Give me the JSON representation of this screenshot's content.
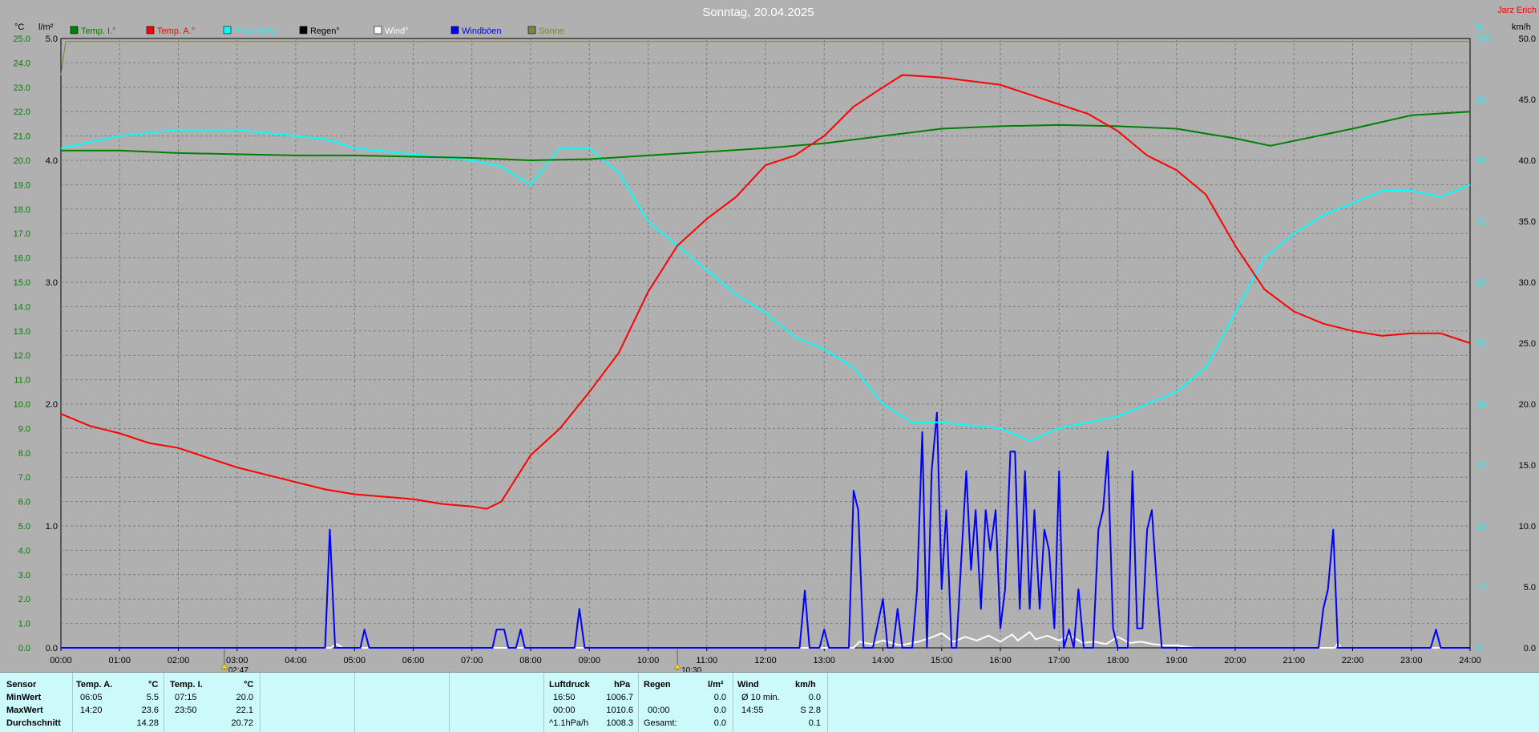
{
  "title": "Sonntag, 20.04.2025",
  "author": "Jarz Erich",
  "units": {
    "left1": "°C",
    "left2": "l/m²",
    "right1": "%",
    "right2": "km/h"
  },
  "legend": [
    {
      "label": "Temp. I.°",
      "color": "#008000"
    },
    {
      "label": "Temp. A.°",
      "color": "#ff0000"
    },
    {
      "label": "Feuchte A.°",
      "color": "#00ffff"
    },
    {
      "label": "Regen°",
      "color": "#000000"
    },
    {
      "label": "Wind°",
      "color": "#ffffff"
    },
    {
      "label": "Windböen",
      "color": "#0000ff"
    },
    {
      "label": "Sonne",
      "color": "#808040"
    }
  ],
  "markers": [
    "02:47",
    "10:30"
  ],
  "chart_data": {
    "type": "line",
    "x_unit": "hour",
    "xlim": [
      0,
      24
    ],
    "x_ticks": [
      "00:00",
      "01:00",
      "02:00",
      "03:00",
      "04:00",
      "05:00",
      "06:00",
      "07:00",
      "08:00",
      "09:00",
      "10:00",
      "11:00",
      "12:00",
      "13:00",
      "14:00",
      "15:00",
      "16:00",
      "17:00",
      "18:00",
      "19:00",
      "20:00",
      "21:00",
      "22:00",
      "23:00",
      "24:00"
    ],
    "temp_axis": {
      "min": 0,
      "max": 25,
      "ticks": [
        "0.0",
        "1.0",
        "2.0",
        "3.0",
        "4.0",
        "5.0",
        "6.0",
        "7.0",
        "8.0",
        "9.0",
        "10.0",
        "11.0",
        "12.0",
        "13.0",
        "14.0",
        "15.0",
        "16.0",
        "17.0",
        "18.0",
        "19.0",
        "20.0",
        "21.0",
        "22.0",
        "23.0",
        "24.0",
        "25.0"
      ]
    },
    "rain_axis": {
      "min": 0,
      "max": 5,
      "ticks": [
        "0.0",
        "1.0",
        "2.0",
        "3.0",
        "4.0",
        "5.0"
      ]
    },
    "wind_axis": {
      "min": 0,
      "max": 50,
      "ticks": [
        "0.0",
        "5.0",
        "10.0",
        "15.0",
        "20.0",
        "25.0",
        "30.0",
        "35.0",
        "40.0",
        "45.0",
        "50.0"
      ]
    },
    "humidity_axis": {
      "min": 0,
      "max": 100,
      "ticks": [
        "0",
        "10",
        "20",
        "30",
        "40",
        "50",
        "60",
        "70",
        "80",
        "90",
        "100"
      ]
    },
    "series": [
      {
        "name": "Temp. I.°",
        "color": "#008000",
        "axis": "temp",
        "points": [
          [
            0,
            20.4
          ],
          [
            1,
            20.4
          ],
          [
            2,
            20.3
          ],
          [
            3,
            20.25
          ],
          [
            4,
            20.2
          ],
          [
            5,
            20.2
          ],
          [
            6,
            20.15
          ],
          [
            7,
            20.1
          ],
          [
            8,
            20.0
          ],
          [
            9,
            20.05
          ],
          [
            10,
            20.2
          ],
          [
            11,
            20.35
          ],
          [
            12,
            20.5
          ],
          [
            13,
            20.7
          ],
          [
            14,
            21.0
          ],
          [
            15,
            21.3
          ],
          [
            16,
            21.4
          ],
          [
            17,
            21.45
          ],
          [
            18,
            21.4
          ],
          [
            19,
            21.3
          ],
          [
            20,
            20.9
          ],
          [
            20.6,
            20.6
          ],
          [
            21,
            20.8
          ],
          [
            22,
            21.3
          ],
          [
            23,
            21.85
          ],
          [
            24,
            22.0
          ]
        ]
      },
      {
        "name": "Temp. A.°",
        "color": "#ff0000",
        "axis": "temp",
        "points": [
          [
            0,
            9.6
          ],
          [
            0.5,
            9.1
          ],
          [
            1,
            8.8
          ],
          [
            1.5,
            8.4
          ],
          [
            2,
            8.2
          ],
          [
            2.5,
            7.8
          ],
          [
            3,
            7.4
          ],
          [
            3.5,
            7.1
          ],
          [
            4,
            6.8
          ],
          [
            4.5,
            6.5
          ],
          [
            5,
            6.3
          ],
          [
            5.5,
            6.2
          ],
          [
            6,
            6.1
          ],
          [
            6.5,
            5.9
          ],
          [
            7,
            5.8
          ],
          [
            7.25,
            5.7
          ],
          [
            7.5,
            6.0
          ],
          [
            8,
            7.9
          ],
          [
            8.5,
            9.0
          ],
          [
            9,
            10.5
          ],
          [
            9.5,
            12.1
          ],
          [
            10,
            14.6
          ],
          [
            10.5,
            16.5
          ],
          [
            11,
            17.6
          ],
          [
            11.5,
            18.5
          ],
          [
            12,
            19.8
          ],
          [
            12.5,
            20.2
          ],
          [
            13,
            21.0
          ],
          [
            13.5,
            22.2
          ],
          [
            14,
            23.0
          ],
          [
            14.33,
            23.5
          ],
          [
            15,
            23.4
          ],
          [
            16,
            23.1
          ],
          [
            16.5,
            22.7
          ],
          [
            17,
            22.3
          ],
          [
            17.5,
            21.9
          ],
          [
            18,
            21.2
          ],
          [
            18.5,
            20.2
          ],
          [
            19,
            19.6
          ],
          [
            19.5,
            18.6
          ],
          [
            20,
            16.5
          ],
          [
            20.5,
            14.7
          ],
          [
            21,
            13.8
          ],
          [
            21.5,
            13.3
          ],
          [
            22,
            13.0
          ],
          [
            22.5,
            12.8
          ],
          [
            23,
            12.9
          ],
          [
            23.5,
            12.9
          ],
          [
            24,
            12.5
          ]
        ]
      },
      {
        "name": "Feuchte A.°",
        "color": "#00ffff",
        "axis": "humidity",
        "points": [
          [
            0,
            82
          ],
          [
            0.5,
            83
          ],
          [
            1,
            84
          ],
          [
            1.5,
            84.5
          ],
          [
            2,
            85
          ],
          [
            3,
            85
          ],
          [
            4,
            84
          ],
          [
            4.5,
            83.5
          ],
          [
            5,
            82
          ],
          [
            6,
            81
          ],
          [
            7,
            80
          ],
          [
            7.5,
            79
          ],
          [
            8,
            76
          ],
          [
            8.5,
            82
          ],
          [
            9,
            82
          ],
          [
            9.5,
            78
          ],
          [
            10,
            70
          ],
          [
            10.5,
            66
          ],
          [
            11,
            62
          ],
          [
            11.5,
            58
          ],
          [
            12,
            55
          ],
          [
            12.5,
            51
          ],
          [
            13,
            49
          ],
          [
            13.5,
            46
          ],
          [
            14,
            40
          ],
          [
            14.5,
            37
          ],
          [
            15,
            37
          ],
          [
            16,
            36
          ],
          [
            16.5,
            34
          ],
          [
            17,
            36
          ],
          [
            18,
            38
          ],
          [
            18.5,
            40
          ],
          [
            19,
            42
          ],
          [
            19.5,
            46
          ],
          [
            20,
            55
          ],
          [
            20.5,
            64
          ],
          [
            21,
            68
          ],
          [
            21.5,
            71
          ],
          [
            22,
            73
          ],
          [
            22.5,
            75
          ],
          [
            23,
            75
          ],
          [
            23.5,
            74
          ],
          [
            24,
            76
          ]
        ]
      },
      {
        "name": "Windböen",
        "color": "#0000ff",
        "axis": "wind",
        "points": [
          [
            0,
            0
          ],
          [
            4.5,
            0
          ],
          [
            4.58,
            9.7
          ],
          [
            4.67,
            0
          ],
          [
            5.1,
            0
          ],
          [
            5.17,
            1.5
          ],
          [
            5.25,
            0
          ],
          [
            7.35,
            0
          ],
          [
            7.42,
            1.5
          ],
          [
            7.55,
            1.5
          ],
          [
            7.62,
            0
          ],
          [
            7.75,
            0
          ],
          [
            7.83,
            1.5
          ],
          [
            7.9,
            0
          ],
          [
            8.75,
            0
          ],
          [
            8.83,
            3.2
          ],
          [
            8.92,
            0
          ],
          [
            12.58,
            0
          ],
          [
            12.67,
            4.7
          ],
          [
            12.75,
            0
          ],
          [
            12.92,
            0
          ],
          [
            13.0,
            1.5
          ],
          [
            13.08,
            0
          ],
          [
            13.42,
            0
          ],
          [
            13.5,
            12.9
          ],
          [
            13.58,
            11.3
          ],
          [
            13.67,
            0
          ],
          [
            13.83,
            0
          ],
          [
            14.0,
            4.0
          ],
          [
            14.08,
            0
          ],
          [
            14.17,
            0
          ],
          [
            14.25,
            3.2
          ],
          [
            14.33,
            0
          ],
          [
            14.5,
            0
          ],
          [
            14.58,
            4.7
          ],
          [
            14.67,
            17.7
          ],
          [
            14.75,
            0
          ],
          [
            14.83,
            14.5
          ],
          [
            14.92,
            19.3
          ],
          [
            15.0,
            4.8
          ],
          [
            15.08,
            11.3
          ],
          [
            15.17,
            0
          ],
          [
            15.25,
            0
          ],
          [
            15.42,
            14.5
          ],
          [
            15.5,
            6.4
          ],
          [
            15.58,
            11.3
          ],
          [
            15.67,
            3.2
          ],
          [
            15.75,
            11.3
          ],
          [
            15.83,
            8.0
          ],
          [
            15.92,
            11.3
          ],
          [
            16.0,
            1.6
          ],
          [
            16.08,
            4.8
          ],
          [
            16.17,
            16.1
          ],
          [
            16.25,
            16.1
          ],
          [
            16.33,
            3.2
          ],
          [
            16.42,
            14.5
          ],
          [
            16.5,
            3.2
          ],
          [
            16.58,
            11.3
          ],
          [
            16.67,
            3.2
          ],
          [
            16.75,
            9.7
          ],
          [
            16.83,
            8.0
          ],
          [
            16.92,
            1.6
          ],
          [
            17.0,
            14.5
          ],
          [
            17.08,
            0
          ],
          [
            17.17,
            1.5
          ],
          [
            17.25,
            0
          ],
          [
            17.33,
            4.8
          ],
          [
            17.42,
            0
          ],
          [
            17.58,
            0
          ],
          [
            17.67,
            9.7
          ],
          [
            17.75,
            11.3
          ],
          [
            17.83,
            16.1
          ],
          [
            17.92,
            1.6
          ],
          [
            18.0,
            0
          ],
          [
            18.17,
            0
          ],
          [
            18.25,
            14.5
          ],
          [
            18.33,
            1.6
          ],
          [
            18.42,
            1.6
          ],
          [
            18.5,
            9.7
          ],
          [
            18.58,
            11.3
          ],
          [
            18.67,
            4.8
          ],
          [
            18.75,
            0
          ],
          [
            21.42,
            0
          ],
          [
            21.5,
            3.2
          ],
          [
            21.58,
            4.8
          ],
          [
            21.67,
            9.7
          ],
          [
            21.75,
            0
          ],
          [
            23.33,
            0
          ],
          [
            23.42,
            1.5
          ],
          [
            23.5,
            0
          ],
          [
            24,
            0
          ]
        ]
      },
      {
        "name": "Wind°",
        "color": "#ffffff",
        "axis": "wind",
        "points": [
          [
            0,
            0
          ],
          [
            4.6,
            0
          ],
          [
            4.7,
            0.3
          ],
          [
            4.8,
            0
          ],
          [
            13.5,
            0
          ],
          [
            13.6,
            0.5
          ],
          [
            13.8,
            0.3
          ],
          [
            14.0,
            0.6
          ],
          [
            14.3,
            0.2
          ],
          [
            14.6,
            0.5
          ],
          [
            14.8,
            0.8
          ],
          [
            15.0,
            1.2
          ],
          [
            15.2,
            0.5
          ],
          [
            15.4,
            0.9
          ],
          [
            15.6,
            0.6
          ],
          [
            15.8,
            1.0
          ],
          [
            16.0,
            0.5
          ],
          [
            16.2,
            1.1
          ],
          [
            16.3,
            0.6
          ],
          [
            16.5,
            1.3
          ],
          [
            16.6,
            0.7
          ],
          [
            16.8,
            1.0
          ],
          [
            17.0,
            0.6
          ],
          [
            17.2,
            1.0
          ],
          [
            17.4,
            0.4
          ],
          [
            17.6,
            0.5
          ],
          [
            17.8,
            0.3
          ],
          [
            18.0,
            0.9
          ],
          [
            18.2,
            0.4
          ],
          [
            18.4,
            0.5
          ],
          [
            18.6,
            0.3
          ],
          [
            18.8,
            0.2
          ],
          [
            19.0,
            0.2
          ],
          [
            19.3,
            0
          ],
          [
            21.7,
            0
          ],
          [
            21.75,
            0.4
          ],
          [
            21.8,
            0
          ],
          [
            24,
            0
          ]
        ]
      },
      {
        "name": "Sonne",
        "color": "#808040",
        "axis": "humidity",
        "points": [
          [
            0,
            94
          ],
          [
            0.08,
            99.5
          ],
          [
            24,
            99.5
          ]
        ]
      }
    ]
  },
  "stats": {
    "sensor": "Sensor",
    "min_label": "MinWert",
    "max_label": "MaxWert",
    "avg_label": "Durchschnitt",
    "temp_a": {
      "header": "Temp. A.",
      "unit": "°C",
      "min_time": "06:05",
      "min": "5.5",
      "max_time": "14:20",
      "max": "23.6",
      "avg": "14.28"
    },
    "temp_i": {
      "header": "Temp. I.",
      "unit": "°C",
      "min_time": "07:15",
      "min": "20.0",
      "max_time": "23:50",
      "max": "22.1",
      "avg": "20.72"
    },
    "pressure": {
      "header": "Luftdruck",
      "unit": "hPa",
      "min_time": "16:50",
      "min": "1006.7",
      "max_time": "00:00",
      "max": "1010.6",
      "trend_label": "^1.1hPa/h",
      "trend": "1008.3"
    },
    "rain": {
      "header": "Regen",
      "unit": "l/m²",
      "empty": "",
      "v1": "0.0",
      "time": "00:00",
      "v2": "0.0",
      "total_label": "Gesamt:",
      "total": "0.0"
    },
    "wind": {
      "header": "Wind",
      "unit": "km/h",
      "avg_label": "Ø 10 min.",
      "avg": "0.0",
      "max_time": "14:55",
      "max": "S 2.8",
      "v3": "0.1"
    }
  }
}
